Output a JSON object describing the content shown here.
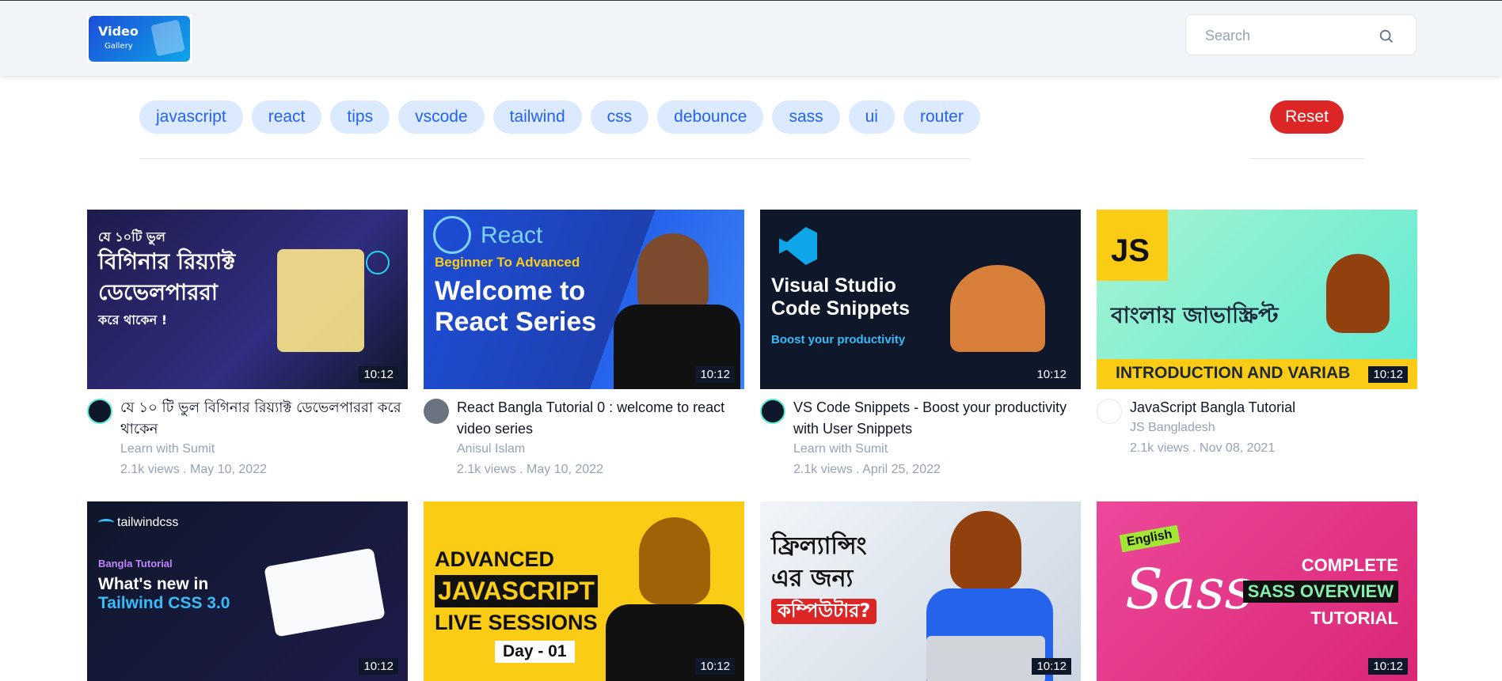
{
  "header": {
    "logo_line1": "Video",
    "logo_line2": "Gallery",
    "search_placeholder": "Search",
    "search_value": ""
  },
  "tags": [
    "javascript",
    "react",
    "tips",
    "vscode",
    "tailwind",
    "css",
    "debounce",
    "sass",
    "ui",
    "router"
  ],
  "reset_label": "Reset",
  "videos": [
    {
      "thumb_text": [
        "যে ১০টি ভুল",
        "বিগিনার রিয়্যাক্ট",
        "ডেভেলপাররা",
        "করে থাকেন !"
      ],
      "duration": "10:12",
      "title": "যে ১০ টি ভুল বিগিনার রিয়্যাক্ট ডেভেলপাররা করে থাকেন",
      "channel": "Learn with Sumit",
      "stats": "2.1k views . May 10, 2022",
      "bg": "#1e1b4b",
      "accent": "#22d3ee"
    },
    {
      "thumb_text": [
        "React",
        "Beginner To Advanced",
        "Welcome to",
        "React Series"
      ],
      "duration": "10:12",
      "title": "React Bangla Tutorial 0 : welcome to react video series",
      "channel": "Anisul Islam",
      "stats": "2.1k views . May 10, 2022",
      "bg": "#1d4ed8",
      "accent": "#facc15"
    },
    {
      "thumb_text": [
        "Visual Studio",
        "Code Snippets",
        "Boost your productivity"
      ],
      "duration": "10:12",
      "title": "VS Code Snippets - Boost your productivity with User Snippets",
      "channel": "Learn with Sumit",
      "stats": "2.1k views . April 25, 2022",
      "bg": "#0f172a",
      "accent": "#38bdf8"
    },
    {
      "thumb_text": [
        "JS",
        "বাংলায় জাভাস্ক্রিপ্ট",
        "INTRODUCTION AND VARIAB"
      ],
      "duration": "10:12",
      "title": "JavaScript Bangla Tutorial",
      "channel": "JS Bangladesh",
      "stats": "2.1k views . Nov 08, 2021",
      "bg": "#5eead4",
      "accent": "#facc15"
    },
    {
      "thumb_text": [
        "tailwindcss",
        "Bangla Tutorial",
        "What's new in",
        "Tailwind CSS 3.0"
      ],
      "duration": "10:12",
      "bg": "#111827",
      "accent": "#38bdf8"
    },
    {
      "thumb_text": [
        "ADVANCED",
        "JAVASCRIPT",
        "LIVE SESSIONS",
        "Day - 01"
      ],
      "duration": "10:12",
      "bg": "#facc15",
      "accent": "#111827"
    },
    {
      "thumb_text": [
        "ফ্রিল্যান্সিং",
        "এর জন্য",
        "কম্পিউটার?"
      ],
      "duration": "10:12",
      "bg": "#e5e7eb",
      "accent": "#dc2626"
    },
    {
      "thumb_text": [
        "English",
        "Sass",
        "COMPLETE",
        "SASS OVERVIEW",
        "TUTORIAL"
      ],
      "duration": "10:12",
      "bg": "#db2777",
      "accent": "#86efac"
    }
  ],
  "colors": {
    "primary": "#2563eb",
    "tag_bg": "#dbeafe",
    "reset": "#dc2626",
    "muted": "#94a3b8"
  }
}
